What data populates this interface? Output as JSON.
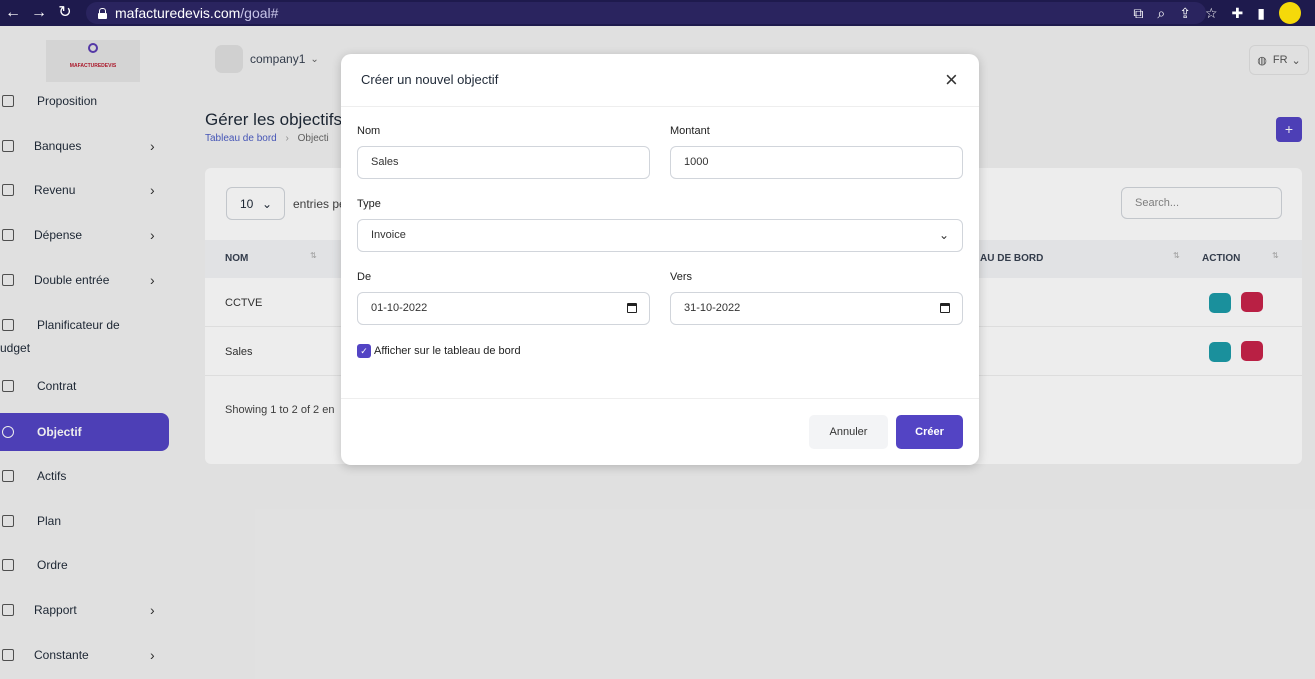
{
  "browser": {
    "url_host": "mafacturedevis.com",
    "url_path": "/goal#"
  },
  "sidebar": {
    "logo_text": "MAFACTUREDEVIS",
    "items": [
      {
        "label": "Proposition",
        "icon": "document-icon",
        "has_chevron": false
      },
      {
        "label": "Banques",
        "icon": "bank-icon",
        "has_chevron": true
      },
      {
        "label": "Revenu",
        "icon": "file-icon",
        "has_chevron": true
      },
      {
        "label": "Dépense",
        "icon": "clipboard-icon",
        "has_chevron": true
      },
      {
        "label": "Double entrée",
        "icon": "scale-icon",
        "has_chevron": true
      },
      {
        "label": "Planificateur de",
        "icon": "database-icon",
        "has_chevron": false
      },
      {
        "label": "Contrat",
        "icon": "database-icon",
        "has_chevron": false
      },
      {
        "label": "Objectif",
        "icon": "target-icon",
        "has_chevron": false,
        "active": true
      },
      {
        "label": "Actifs",
        "icon": "calculator-icon",
        "has_chevron": false
      },
      {
        "label": "Plan",
        "icon": "trophy-icon",
        "has_chevron": false
      },
      {
        "label": "Ordre",
        "icon": "cart-icon",
        "has_chevron": false
      },
      {
        "label": "Rapport",
        "icon": "chart-icon",
        "has_chevron": true
      },
      {
        "label": "Constante",
        "icon": "settings-icon",
        "has_chevron": true
      }
    ],
    "budget_continuation": "udget"
  },
  "topbar": {
    "company_name": "company1",
    "language": "FR"
  },
  "page": {
    "title": "Gérer les objectifs",
    "breadcrumb_home": "Tableau de bord",
    "breadcrumb_current": "Objecti"
  },
  "table": {
    "entries_value": "10",
    "entries_label": "entries pe",
    "search_placeholder": "Search...",
    "columns": [
      "NOM",
      "AU DE BORD",
      "ACTION"
    ],
    "rows": [
      {
        "nom": "CCTVE"
      },
      {
        "nom": "Sales"
      }
    ],
    "showing_text": "Showing 1 to 2 of 2 en"
  },
  "modal": {
    "title": "Créer un nouvel objectif",
    "nom_label": "Nom",
    "nom_value": "Sales",
    "montant_label": "Montant",
    "montant_value": "1000",
    "type_label": "Type",
    "type_value": "Invoice",
    "de_label": "De",
    "de_value": "01-10-2022",
    "vers_label": "Vers",
    "vers_value": "31-10-2022",
    "checkbox_label": "Afficher sur le tableau de bord",
    "checkbox_checked": true,
    "cancel_label": "Annuler",
    "create_label": "Créer"
  },
  "colors": {
    "primary": "#5344c4",
    "edit": "#1c9ba8",
    "delete": "#c8234a",
    "browser_bar": "#1e1a4d"
  }
}
